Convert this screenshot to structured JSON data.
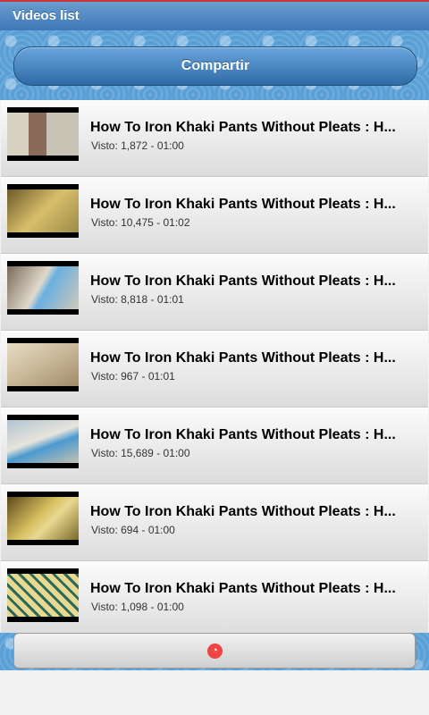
{
  "app": {
    "title": "Videos list"
  },
  "share": {
    "label": "Compartir"
  },
  "videos": [
    {
      "title": "How To Iron Khaki Pants Without Pleats : H...",
      "meta": "Visto: 1,872 - 01:00"
    },
    {
      "title": "How To Iron Khaki Pants Without Pleats : H...",
      "meta": "Visto: 10,475 - 01:02"
    },
    {
      "title": "How To Iron Khaki Pants Without Pleats : H...",
      "meta": "Visto: 8,818 - 01:01"
    },
    {
      "title": "How To Iron Khaki Pants Without Pleats : H...",
      "meta": "Visto: 967 - 01:01"
    },
    {
      "title": "How To Iron Khaki Pants Without Pleats : H...",
      "meta": "Visto: 15,689 - 01:00"
    },
    {
      "title": "How To Iron Khaki Pants Without Pleats : H...",
      "meta": "Visto: 694 - 01:00"
    },
    {
      "title": "How To Iron Khaki Pants Without Pleats : H...",
      "meta": "Visto: 1,098 - 01:00"
    }
  ],
  "bottom": {
    "icon": "ad-icon"
  },
  "colors": {
    "header": "#3f78b8",
    "share_button": "#2f6aa6",
    "pattern": "#5aa0d6"
  }
}
